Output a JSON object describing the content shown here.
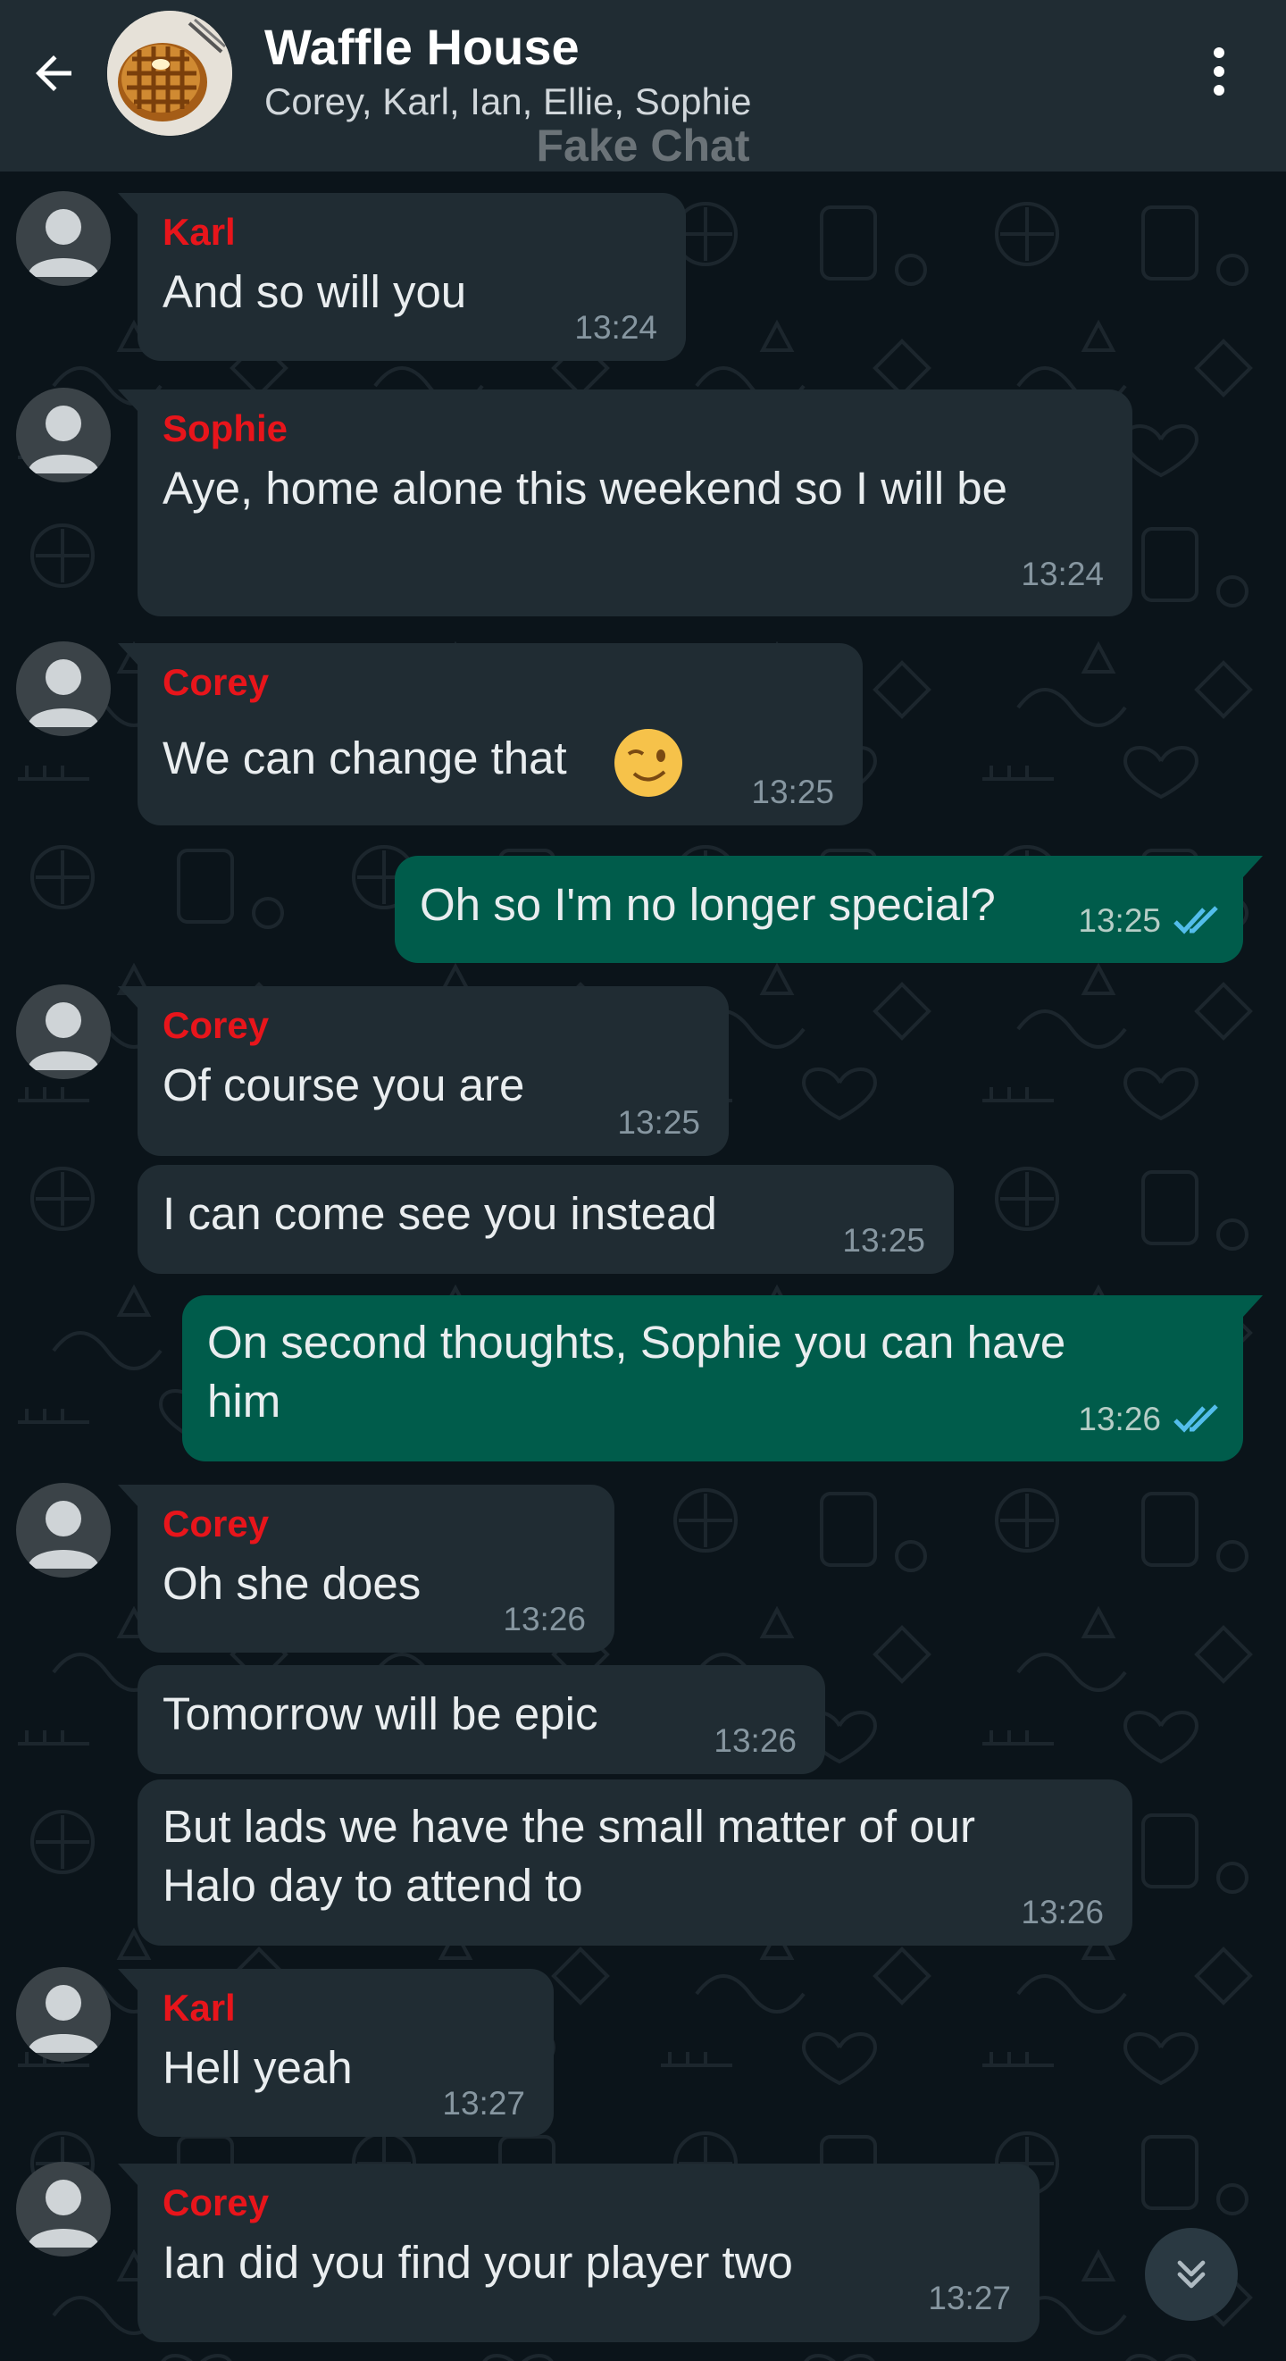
{
  "header": {
    "title": "Waffle House",
    "participants": "Corey, Karl, Ian, Ellie, Sophie",
    "watermark": "Fake Chat"
  },
  "messages": [
    {
      "sender": "Karl",
      "lines": [
        "And so will you"
      ],
      "time": "13:24"
    },
    {
      "sender": "Sophie",
      "lines": [
        "Aye, home alone this weekend so I will be"
      ],
      "time": "13:24"
    },
    {
      "sender": "Corey",
      "lines": [
        "We can change that"
      ],
      "emoji": "winking-face",
      "time": "13:25"
    },
    {
      "outgoing": true,
      "lines": [
        "Oh so I'm no longer special?"
      ],
      "time": "13:25",
      "status": "read"
    },
    {
      "sender": "Corey",
      "lines": [
        "Of course you are"
      ],
      "time": "13:25"
    },
    {
      "lines": [
        "I can come see you instead"
      ],
      "time": "13:25"
    },
    {
      "outgoing": true,
      "lines": [
        "On second thoughts, Sophie you can have",
        "him"
      ],
      "time": "13:26",
      "status": "read"
    },
    {
      "sender": "Corey",
      "lines": [
        "Oh she does"
      ],
      "time": "13:26"
    },
    {
      "lines": [
        "Tomorrow will be epic"
      ],
      "time": "13:26"
    },
    {
      "lines": [
        "But lads we have the small matter of our",
        "Halo day to attend to"
      ],
      "time": "13:26"
    },
    {
      "sender": "Karl",
      "lines": [
        "Hell yeah"
      ],
      "time": "13:27"
    },
    {
      "sender": "Corey",
      "lines": [
        "Ian did you find your player two"
      ],
      "time": "13:27"
    }
  ],
  "colors": {
    "background": "#0b141a",
    "header": "#202c33",
    "incoming_bubble": "#202c33",
    "outgoing_bubble": "#005c4b",
    "sender_name": "#e8151b",
    "read_ticks": "#53bdeb"
  },
  "icons": [
    "arrow-left-icon",
    "waffle-group-avatar",
    "more-vert-icon",
    "default-user-avatar",
    "double-check-icon",
    "chevron-double-down-icon"
  ]
}
